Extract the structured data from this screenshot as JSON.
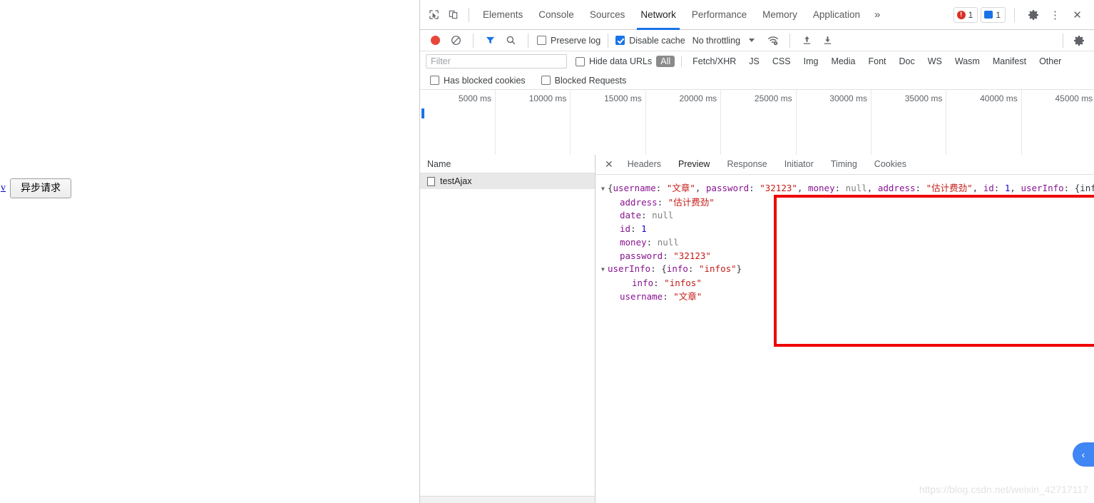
{
  "page": {
    "link_text": "v",
    "button_label": "异步请求"
  },
  "devtools": {
    "icons": {
      "inspect": "inspect-element-icon",
      "device": "device-toolbar-icon",
      "more_tabs": "»",
      "settings": "gear-icon",
      "kebab": "⋮",
      "close": "✕"
    },
    "tabs": [
      {
        "label": "Elements",
        "active": false
      },
      {
        "label": "Console",
        "active": false
      },
      {
        "label": "Sources",
        "active": false
      },
      {
        "label": "Network",
        "active": true
      },
      {
        "label": "Performance",
        "active": false
      },
      {
        "label": "Memory",
        "active": false
      },
      {
        "label": "Application",
        "active": false
      }
    ],
    "status": {
      "error_count": "1",
      "message_count": "1"
    },
    "toolbar": {
      "record_title": "record-button",
      "clear_title": "clear-button",
      "filter_title": "filter-toggle",
      "search_title": "search-button",
      "preserve_log": "Preserve log",
      "preserve_log_checked": false,
      "disable_cache": "Disable cache",
      "disable_cache_checked": true,
      "throttling": "No throttling",
      "import_title": "import-har-button",
      "export_title": "export-har-button",
      "network_settings_title": "network-conditions-icon",
      "settings_title": "network-settings-gear"
    },
    "filterbar": {
      "placeholder": "Filter",
      "value": "",
      "hide_data_urls": "Hide data URLs",
      "hide_data_urls_checked": false,
      "types": [
        {
          "label": "All",
          "selected": true
        },
        {
          "label": "Fetch/XHR",
          "selected": false
        },
        {
          "label": "JS",
          "selected": false
        },
        {
          "label": "CSS",
          "selected": false
        },
        {
          "label": "Img",
          "selected": false
        },
        {
          "label": "Media",
          "selected": false
        },
        {
          "label": "Font",
          "selected": false
        },
        {
          "label": "Doc",
          "selected": false
        },
        {
          "label": "WS",
          "selected": false
        },
        {
          "label": "Wasm",
          "selected": false
        },
        {
          "label": "Manifest",
          "selected": false
        },
        {
          "label": "Other",
          "selected": false
        }
      ]
    },
    "blockedbar": {
      "has_blocked_cookies": "Has blocked cookies",
      "has_blocked_cookies_checked": false,
      "blocked_requests": "Blocked Requests",
      "blocked_requests_checked": false
    },
    "overview": {
      "ticks": [
        "5000 ms",
        "10000 ms",
        "15000 ms",
        "20000 ms",
        "25000 ms",
        "30000 ms",
        "35000 ms",
        "40000 ms",
        "45000 ms"
      ]
    },
    "requests": {
      "column_header": "Name",
      "rows": [
        {
          "name": "testAjax",
          "selected": true
        }
      ]
    },
    "detail": {
      "tabs": [
        {
          "label": "Headers",
          "active": false
        },
        {
          "label": "Preview",
          "active": true
        },
        {
          "label": "Response",
          "active": false
        },
        {
          "label": "Initiator",
          "active": false
        },
        {
          "label": "Timing",
          "active": false
        },
        {
          "label": "Cookies",
          "active": false
        }
      ],
      "preview_lines": [
        {
          "indent": 0,
          "triangle": "▼",
          "tokens": [
            {
              "t": "p",
              "v": "{"
            },
            {
              "t": "k",
              "v": "username"
            },
            {
              "t": "p",
              "v": ": "
            },
            {
              "t": "s",
              "v": "\"文章\""
            },
            {
              "t": "p",
              "v": ", "
            },
            {
              "t": "k",
              "v": "password"
            },
            {
              "t": "p",
              "v": ": "
            },
            {
              "t": "s",
              "v": "\"32123\""
            },
            {
              "t": "p",
              "v": ", "
            },
            {
              "t": "k",
              "v": "money"
            },
            {
              "t": "p",
              "v": ": "
            },
            {
              "t": "nl",
              "v": "null"
            },
            {
              "t": "p",
              "v": ", "
            },
            {
              "t": "k",
              "v": "address"
            },
            {
              "t": "p",
              "v": ": "
            },
            {
              "t": "s",
              "v": "\"估计费劲\""
            },
            {
              "t": "p",
              "v": ", "
            },
            {
              "t": "k",
              "v": "id"
            },
            {
              "t": "p",
              "v": ": "
            },
            {
              "t": "n",
              "v": "1"
            },
            {
              "t": "p",
              "v": ", "
            },
            {
              "t": "k",
              "v": "userInfo"
            },
            {
              "t": "p",
              "v": ": {info: \"infos\"}}"
            }
          ]
        },
        {
          "indent": 1,
          "triangle": "",
          "tokens": [
            {
              "t": "k",
              "v": "address"
            },
            {
              "t": "p",
              "v": ": "
            },
            {
              "t": "s",
              "v": "\"估计费劲\""
            }
          ]
        },
        {
          "indent": 1,
          "triangle": "",
          "tokens": [
            {
              "t": "k",
              "v": "date"
            },
            {
              "t": "p",
              "v": ": "
            },
            {
              "t": "nl",
              "v": "null"
            }
          ]
        },
        {
          "indent": 1,
          "triangle": "",
          "tokens": [
            {
              "t": "k",
              "v": "id"
            },
            {
              "t": "p",
              "v": ": "
            },
            {
              "t": "n",
              "v": "1"
            }
          ]
        },
        {
          "indent": 1,
          "triangle": "",
          "tokens": [
            {
              "t": "k",
              "v": "money"
            },
            {
              "t": "p",
              "v": ": "
            },
            {
              "t": "nl",
              "v": "null"
            }
          ]
        },
        {
          "indent": 1,
          "triangle": "",
          "tokens": [
            {
              "t": "k",
              "v": "password"
            },
            {
              "t": "p",
              "v": ": "
            },
            {
              "t": "s",
              "v": "\"32123\""
            }
          ]
        },
        {
          "indent": 0,
          "triangle": "▼",
          "tokens": [
            {
              "t": "k",
              "v": "userInfo"
            },
            {
              "t": "p",
              "v": ": {"
            },
            {
              "t": "k",
              "v": "info"
            },
            {
              "t": "p",
              "v": ": "
            },
            {
              "t": "s",
              "v": "\"infos\""
            },
            {
              "t": "p",
              "v": "}"
            }
          ]
        },
        {
          "indent": 2,
          "triangle": "",
          "tokens": [
            {
              "t": "k",
              "v": "info"
            },
            {
              "t": "p",
              "v": ": "
            },
            {
              "t": "s",
              "v": "\"infos\""
            }
          ]
        },
        {
          "indent": 1,
          "triangle": "",
          "tokens": [
            {
              "t": "k",
              "v": "username"
            },
            {
              "t": "p",
              "v": ": "
            },
            {
              "t": "s",
              "v": "\"文章\""
            }
          ]
        }
      ]
    }
  },
  "overlay": {
    "side_tab_icon": "‹",
    "watermark": "https://blog.csdn.net/weixin_42717117"
  },
  "colors": {
    "accent": "#1a73e8",
    "record": "#e8453c",
    "annotation": "#ef0000",
    "selected_pill": "#8a8a8a"
  }
}
